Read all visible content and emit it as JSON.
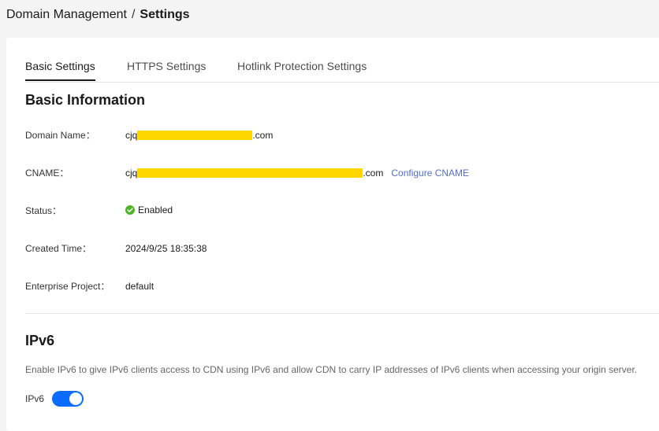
{
  "breadcrumb": {
    "parent": "Domain Management",
    "separator": "/",
    "current": "Settings"
  },
  "tabs": [
    {
      "label": "Basic Settings",
      "active": true
    },
    {
      "label": "HTTPS Settings",
      "active": false
    },
    {
      "label": "Hotlink Protection Settings",
      "active": false
    }
  ],
  "basic_info": {
    "title": "Basic Information",
    "domain_name": {
      "label": "Domain Name：",
      "prefix": "cjq",
      "suffix": ".com"
    },
    "cname": {
      "label": "CNAME：",
      "prefix": "cjq",
      "suffix": ".com",
      "action": "Configure CNAME"
    },
    "status": {
      "label": "Status：",
      "value": "Enabled",
      "icon": "check-circle-icon"
    },
    "created_time": {
      "label": "Created Time：",
      "value": "2024/9/25 18:35:38"
    },
    "enterprise_project": {
      "label": "Enterprise Project：",
      "value": "default"
    }
  },
  "ipv6": {
    "title": "IPv6",
    "description": "Enable IPv6 to give IPv6 clients access to CDN using IPv6 and allow CDN to carry IP addresses of IPv6 clients when accessing your origin server.",
    "toggle_label": "IPv6",
    "enabled": true
  },
  "colors": {
    "accent": "#0a6cff",
    "link": "#526ecc",
    "success": "#50b42a",
    "mask": "#ffd700"
  }
}
